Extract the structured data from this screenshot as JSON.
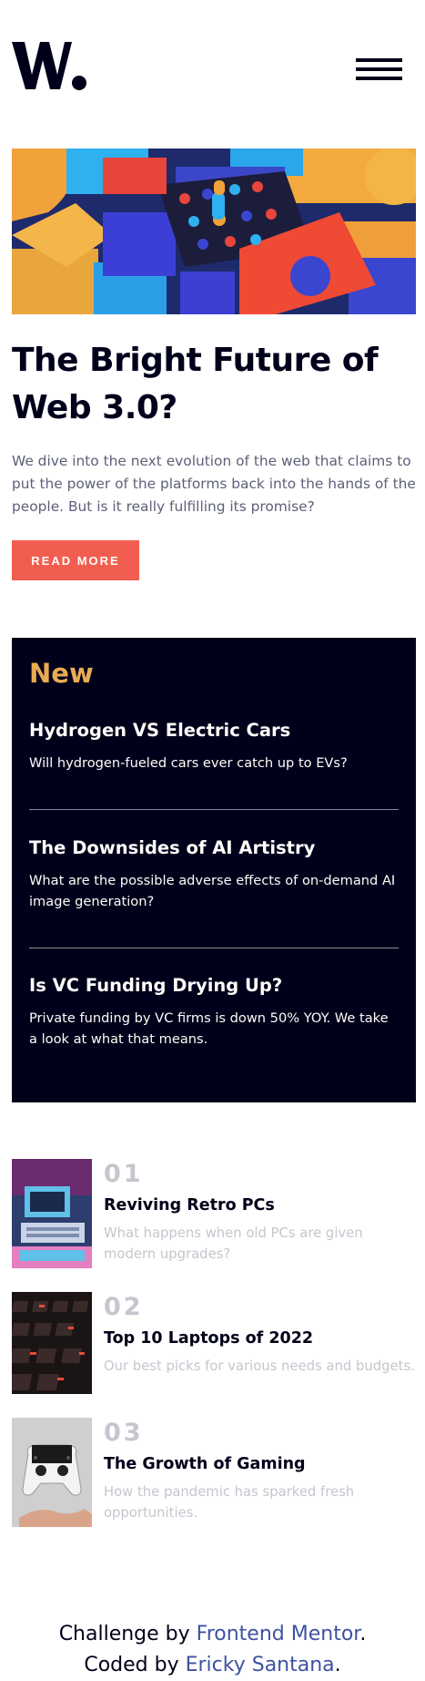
{
  "header": {
    "logo_text": "W.",
    "menu_icon": "hamburger-menu-icon"
  },
  "hero": {
    "image_icon": "web3-blocks-illustration",
    "title": "The Bright Future of Web 3.0?",
    "description": "We dive into the next evolution of the web that claims to put the power of the platforms back into the hands of the people. But is it really fulfilling its promise?",
    "button_label": "READ MORE"
  },
  "new_panel": {
    "heading": "New",
    "items": [
      {
        "title": "Hydrogen VS Electric Cars",
        "text": "Will hydrogen-fueled cars ever catch up to EVs?"
      },
      {
        "title": "The Downsides of AI Artistry",
        "text": "What are the possible adverse effects of on-demand AI image generation?"
      },
      {
        "title": "Is VC Funding Drying Up?",
        "text": "Private funding by VC firms is down 50% YOY. We take a look at what that means."
      }
    ]
  },
  "articles": [
    {
      "number": "01",
      "title": "Reviving Retro PCs",
      "description": "What happens when old PCs are given modern upgrades?",
      "image_icon": "retro-pc-photo"
    },
    {
      "number": "02",
      "title": "Top 10 Laptops of 2022",
      "description": "Our best picks for various needs and budgets.",
      "image_icon": "laptop-keyboard-photo"
    },
    {
      "number": "03",
      "title": "The Growth of Gaming",
      "description": "How the pandemic has sparked fresh opportunities.",
      "image_icon": "game-controller-photo"
    }
  ],
  "footer": {
    "line1_prefix": "Challenge by ",
    "line1_link": "Frontend Mentor",
    "line1_suffix": ".",
    "line2_prefix": "Coded by ",
    "line2_link": "Ericky Santana",
    "line2_suffix": "."
  },
  "colors": {
    "accent_red": "#f15e50",
    "accent_orange": "#e9ab53",
    "dark_navy": "#00001a",
    "grayish_blue": "#c5c6ce",
    "dark_grayish_blue": "#5d5f79",
    "link_blue": "#3e52a3"
  }
}
